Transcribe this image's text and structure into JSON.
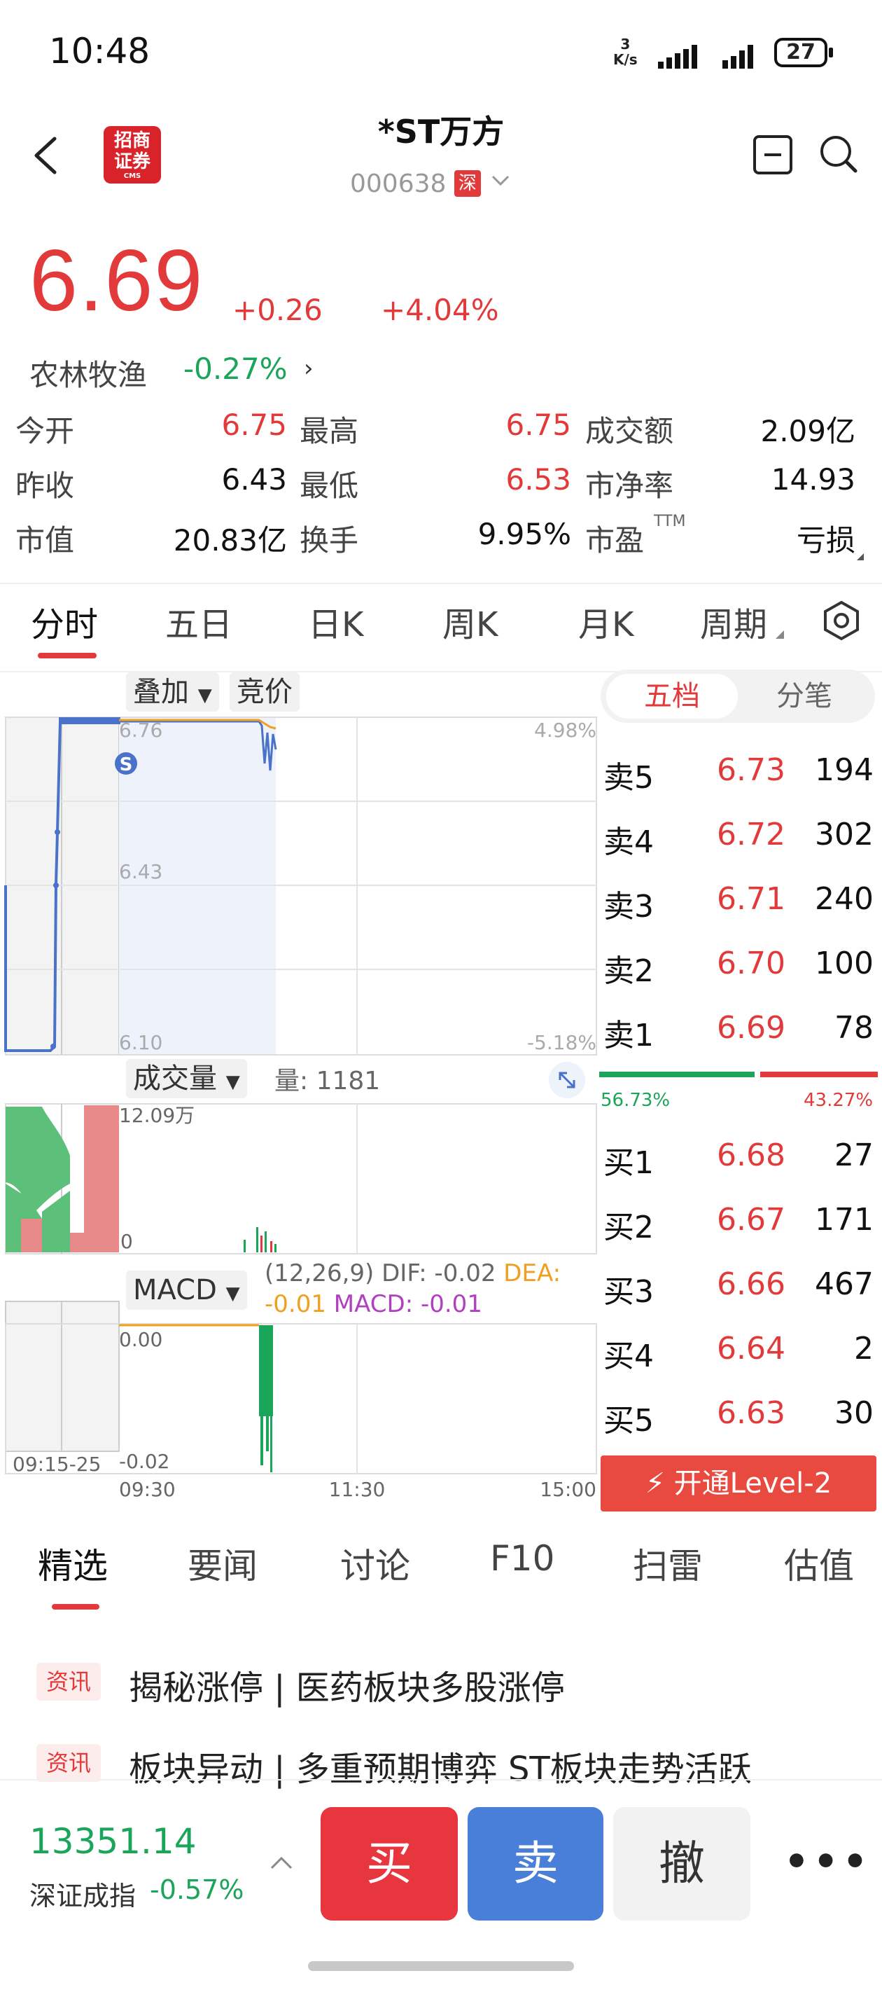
{
  "status_bar": {
    "time": "10:48",
    "net_speed_top": "3",
    "net_speed_unit": "K/s",
    "battery": "27"
  },
  "header": {
    "logo_text_1": "招商",
    "logo_text_2": "证券",
    "logo_sub": "CMS",
    "title": "*ST万方",
    "code": "000638",
    "market": "深"
  },
  "quote": {
    "price": "6.69",
    "change": "+0.26",
    "change_pct": "+4.04%",
    "sector": "农林牧渔",
    "sector_change": "-0.27%"
  },
  "stats": [
    [
      {
        "label": "今开",
        "value": "6.75",
        "color": "red"
      },
      {
        "label": "最高",
        "value": "6.75",
        "color": "red"
      },
      {
        "label": "成交额",
        "value": "2.09亿",
        "color": "black"
      }
    ],
    [
      {
        "label": "昨收",
        "value": "6.43",
        "color": "black"
      },
      {
        "label": "最低",
        "value": "6.53",
        "color": "red"
      },
      {
        "label": "市净率",
        "value": "14.93",
        "color": "black"
      }
    ],
    [
      {
        "label": "市值",
        "value": "20.83亿",
        "color": "black"
      },
      {
        "label": "换手",
        "value": "9.95%",
        "color": "black"
      },
      {
        "label": "市盈",
        "label_sup": "TTM",
        "value": "亏损",
        "color": "black"
      }
    ]
  ],
  "chart_tabs": [
    "分时",
    "五日",
    "日K",
    "周K",
    "月K",
    "周期"
  ],
  "chart": {
    "overlay_label": "叠加",
    "auction_label": "竞价",
    "price_high": "6.76",
    "price_mid": "6.43",
    "price_low": "6.10",
    "pct_high": "4.98%",
    "pct_low": "-5.18%",
    "volume_label": "成交量",
    "volume_text": "量: 1181",
    "volume_max": "12.09万",
    "volume_min": "0",
    "macd_label": "MACD",
    "macd_params": "(12,26,9)",
    "dif": "DIF: -0.02",
    "dea_label": "DEA:",
    "dea_value": "-0.01",
    "macd_value": "MACD: -0.01",
    "macd_top": "0.00",
    "macd_bottom": "-0.02",
    "auction_time": "09:15-25",
    "time_start": "09:30",
    "time_mid": "11:30",
    "time_end": "15:00",
    "s_marker": "S"
  },
  "order_book": {
    "tab_active": "五档",
    "tab_other": "分笔",
    "asks": [
      {
        "label": "卖5",
        "price": "6.73",
        "volume": "194"
      },
      {
        "label": "卖4",
        "price": "6.72",
        "volume": "302"
      },
      {
        "label": "卖3",
        "price": "6.71",
        "volume": "240"
      },
      {
        "label": "卖2",
        "price": "6.70",
        "volume": "100"
      },
      {
        "label": "卖1",
        "price": "6.69",
        "volume": "78"
      }
    ],
    "buy_ratio": "56.73%",
    "sell_ratio": "43.27%",
    "bids": [
      {
        "label": "买1",
        "price": "6.68",
        "volume": "27"
      },
      {
        "label": "买2",
        "price": "6.67",
        "volume": "171"
      },
      {
        "label": "买3",
        "price": "6.66",
        "volume": "467"
      },
      {
        "label": "买4",
        "price": "6.64",
        "volume": "2"
      },
      {
        "label": "买5",
        "price": "6.63",
        "volume": "30"
      }
    ],
    "level2_label": "开通Level-2"
  },
  "news_tabs": [
    "精选",
    "要闻",
    "讨论",
    "F10",
    "扫雷",
    "估值"
  ],
  "news": [
    {
      "tag": "资讯",
      "title": "揭秘涨停 | 医药板块多股涨停"
    },
    {
      "tag": "资讯",
      "title": "板块异动 | 多重预期博弈 ST板块走势活跃"
    }
  ],
  "bottom": {
    "index_value": "13351.14",
    "index_name": "深证成指",
    "index_change": "-0.57%",
    "buy": "买",
    "sell": "卖",
    "cancel": "撤",
    "more": "•••"
  },
  "colors": {
    "up": "#e23a3a",
    "down": "#1aa55a",
    "line": "#4a72c8",
    "avg": "#f0a020"
  }
}
